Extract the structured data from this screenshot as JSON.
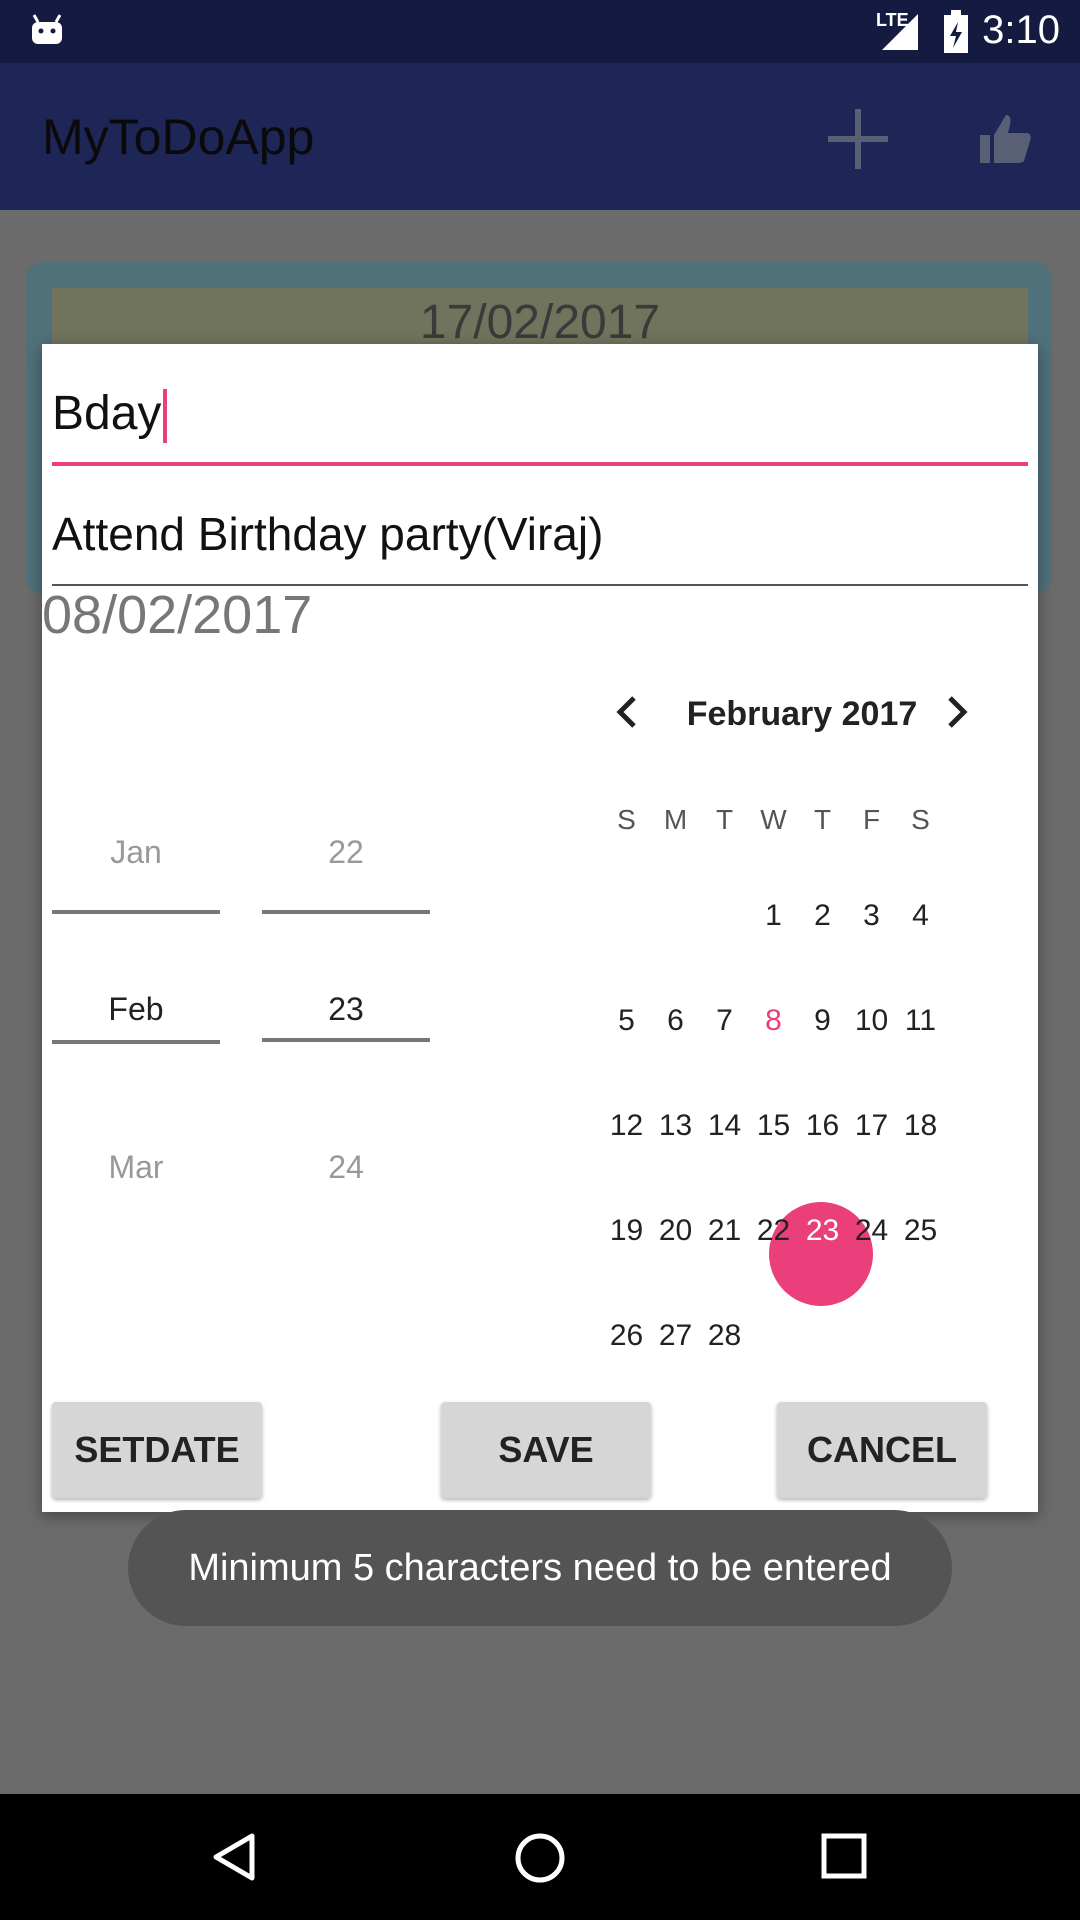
{
  "status_bar": {
    "time": "3:10",
    "network": "LTE"
  },
  "app_bar": {
    "title": "MyToDoApp",
    "icons": [
      "add-icon",
      "thumbs-up-icon"
    ]
  },
  "background_card": {
    "date": "17/02/2017"
  },
  "dialog": {
    "title_value": "Bday",
    "description_value": "Attend Birthday party(Viraj)",
    "selected_date": "08/02/2017",
    "spinner_month": {
      "prev": "Jan",
      "selected": "Feb",
      "next": "Mar"
    },
    "spinner_day": {
      "prev": "22",
      "selected": "23",
      "next": "24"
    },
    "calendar": {
      "month_label": "February 2017",
      "weekdays": [
        "S",
        "M",
        "T",
        "W",
        "T",
        "F",
        "S"
      ],
      "weeks": [
        [
          "",
          "",
          "",
          "1",
          "2",
          "3",
          "4"
        ],
        [
          "5",
          "6",
          "7",
          "8",
          "9",
          "10",
          "11"
        ],
        [
          "12",
          "13",
          "14",
          "15",
          "16",
          "17",
          "18"
        ],
        [
          "19",
          "20",
          "21",
          "22",
          "23",
          "24",
          "25"
        ],
        [
          "26",
          "27",
          "28",
          "",
          "",
          "",
          ""
        ]
      ],
      "today": "8",
      "selected": "23",
      "accent_color": "#ea3f7b"
    },
    "buttons": {
      "set_date": "SETDATE",
      "save": "SAVE",
      "cancel": "CANCEL"
    }
  },
  "toast": {
    "message": "Minimum 5 characters need to be entered"
  }
}
